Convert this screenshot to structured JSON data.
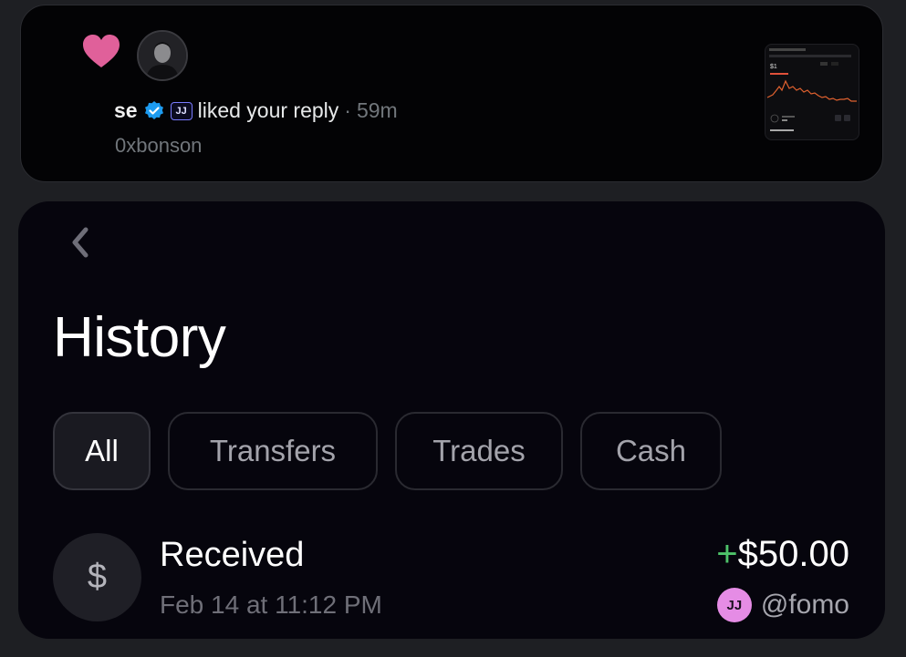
{
  "notification": {
    "user_name": "se",
    "badge_text": "JJ",
    "action_text": "liked your reply",
    "separator": "·",
    "time": "59m",
    "handle": "0xbonson",
    "icons": [
      "heart-icon",
      "verified-badge-icon"
    ],
    "colors": {
      "heart": "#e0609a",
      "verified": "#1d9bf0"
    }
  },
  "history": {
    "title": "History",
    "tabs": [
      {
        "label": "All",
        "active": true
      },
      {
        "label": "Transfers",
        "active": false
      },
      {
        "label": "Trades",
        "active": false
      },
      {
        "label": "Cash",
        "active": false
      }
    ],
    "transactions": [
      {
        "title": "Received",
        "date": "Feb 14 at 11:12 PM",
        "amount_sign": "+",
        "amount": "$50.00",
        "sender_logo": "JJ",
        "sender": "@fomo",
        "icon_symbol": "$"
      }
    ],
    "colors": {
      "positive": "#4ec36a",
      "fomo_brand": "#e58ce5"
    }
  }
}
